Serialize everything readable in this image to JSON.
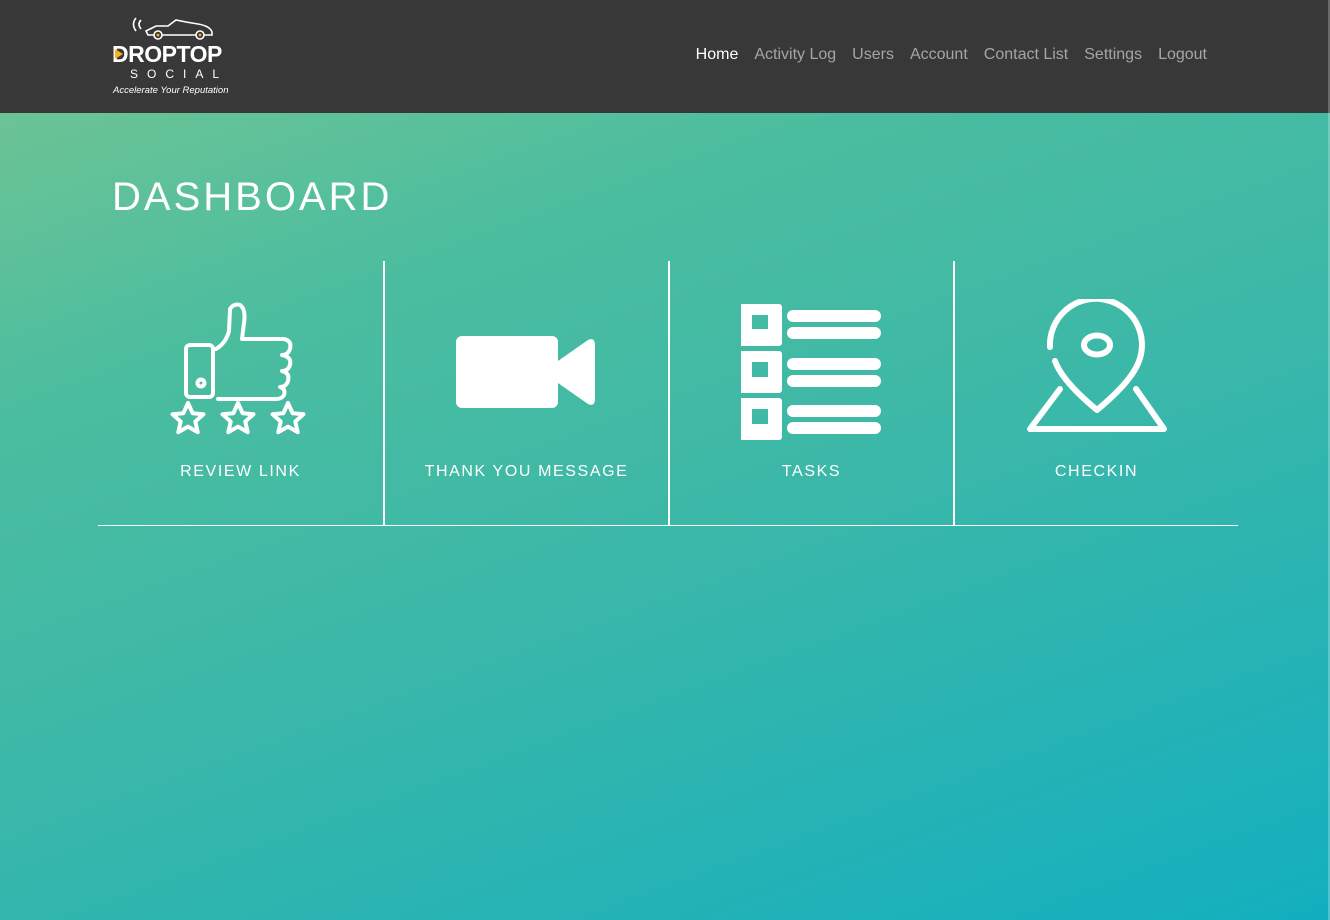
{
  "brand": {
    "name": "DROPTOP",
    "sub": "SOCIAL",
    "tagline": "Accelerate Your Reputation",
    "accent_color": "#f3b51b"
  },
  "nav": {
    "items": [
      {
        "label": "Home",
        "active": true
      },
      {
        "label": "Activity Log"
      },
      {
        "label": "Users"
      },
      {
        "label": "Account"
      },
      {
        "label": "Contact List"
      },
      {
        "label": "Settings"
      },
      {
        "label": "Logout"
      }
    ]
  },
  "page": {
    "title": "DASHBOARD"
  },
  "tiles": [
    {
      "label": "REVIEW LINK",
      "icon": "thumbs-up-stars-icon"
    },
    {
      "label": "THANK YOU MESSAGE",
      "icon": "video-camera-icon"
    },
    {
      "label": "TASKS",
      "icon": "checklist-icon"
    },
    {
      "label": "CHECKIN",
      "icon": "map-pin-icon"
    }
  ],
  "colors": {
    "navbar": "#383838",
    "nav_inactive": "#a5a5a5",
    "nav_active": "#ffffff",
    "gradient_start": "#78c691",
    "gradient_end": "#13afbf"
  }
}
